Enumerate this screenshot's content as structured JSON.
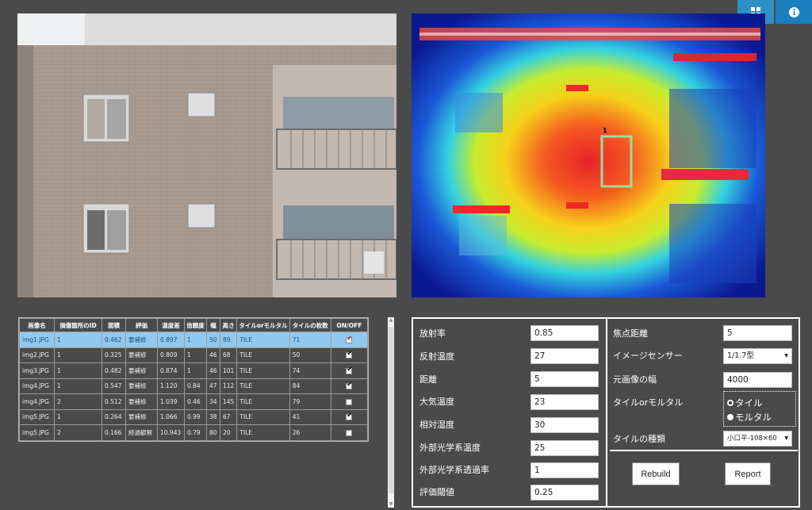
{
  "toolbar": {
    "grid_icon": "grid-icon",
    "info_icon": "info-icon"
  },
  "thermal": {
    "marker_label": "1"
  },
  "table": {
    "headers": [
      "画像名",
      "損傷箇所のID",
      "面積",
      "評価",
      "温度差",
      "信頼度",
      "幅",
      "高さ",
      "タイルorモルタル",
      "タイルの枚数",
      "ON/OFF"
    ],
    "rows": [
      {
        "name": "img1.JPG",
        "id": "1",
        "area": "0.462",
        "eval": "要補修",
        "temp": "0.897",
        "conf": "1",
        "w": "50",
        "h": "89",
        "type": "TILE",
        "count": "71",
        "on": true,
        "selected": true
      },
      {
        "name": "img2.JPG",
        "id": "1",
        "area": "0.325",
        "eval": "要補修",
        "temp": "0.809",
        "conf": "1",
        "w": "46",
        "h": "68",
        "type": "TILE",
        "count": "50",
        "on": true,
        "selected": false
      },
      {
        "name": "img3.JPG",
        "id": "1",
        "area": "0.482",
        "eval": "要補修",
        "temp": "0.874",
        "conf": "1",
        "w": "46",
        "h": "101",
        "type": "TILE",
        "count": "74",
        "on": true,
        "selected": false
      },
      {
        "name": "img4.JPG",
        "id": "1",
        "area": "0.547",
        "eval": "要補修",
        "temp": "1.120",
        "conf": "0.84",
        "w": "47",
        "h": "112",
        "type": "TILE",
        "count": "84",
        "on": true,
        "selected": false
      },
      {
        "name": "img4.JPG",
        "id": "2",
        "area": "0.512",
        "eval": "要補修",
        "temp": "1.039",
        "conf": "0.46",
        "w": "34",
        "h": "145",
        "type": "TILE",
        "count": "79",
        "on": false,
        "selected": false
      },
      {
        "name": "img5.JPG",
        "id": "1",
        "area": "0.264",
        "eval": "要補修",
        "temp": "1.066",
        "conf": "0.99",
        "w": "38",
        "h": "67",
        "type": "TILE",
        "count": "41",
        "on": true,
        "selected": false
      },
      {
        "name": "img5.JPG",
        "id": "2",
        "area": "0.166",
        "eval": "経過観察",
        "temp": "10.943",
        "conf": "0.79",
        "w": "80",
        "h": "20",
        "type": "TILE",
        "count": "26",
        "on": false,
        "selected": false
      }
    ]
  },
  "params": {
    "emissivity": {
      "label": "放射率",
      "value": "0.85"
    },
    "reflect_temp": {
      "label": "反射温度",
      "value": "27"
    },
    "distance": {
      "label": "距離",
      "value": "5"
    },
    "air_temp": {
      "label": "大気温度",
      "value": "23"
    },
    "humidity": {
      "label": "相対湿度",
      "value": "30"
    },
    "ext_optics_temp": {
      "label": "外部光学系温度",
      "value": "25"
    },
    "ext_optics_trans": {
      "label": "外部光学系透過率",
      "value": "1"
    },
    "threshold": {
      "label": "評価閾値",
      "value": "0.25"
    },
    "focal": {
      "label": "焦点距離",
      "value": "5"
    },
    "sensor": {
      "label": "イメージセンサー",
      "value": "1/1.7型"
    },
    "width": {
      "label": "元画像の幅",
      "value": "4000"
    },
    "tile_mortar": {
      "label": "タイルorモルタル",
      "opt1": "タイル",
      "opt2": "モルタル"
    },
    "tile_type": {
      "label": "タイルの種類",
      "value": "小口平-108×60"
    },
    "rebuild": "Rebuild",
    "report": "Report"
  }
}
